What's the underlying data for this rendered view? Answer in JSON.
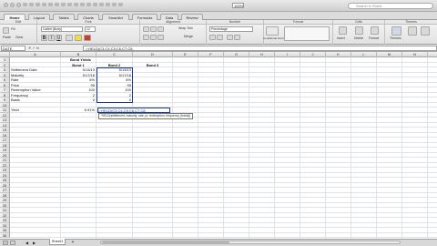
{
  "app": {
    "window_title": "bond_yields.xlsx",
    "zoom": "100%",
    "search_placeholder": "Search in Sheet"
  },
  "tabs": [
    {
      "label": "Home",
      "active": true
    },
    {
      "label": "Layout",
      "active": false
    },
    {
      "label": "Tables",
      "active": false
    },
    {
      "label": "Charts",
      "active": false
    },
    {
      "label": "SmartArt",
      "active": false
    },
    {
      "label": "Formulas",
      "active": false
    },
    {
      "label": "Data",
      "active": false
    },
    {
      "label": "Review",
      "active": false
    }
  ],
  "ribbon": {
    "groups": [
      "Edit",
      "Font",
      "Alignment",
      "Number",
      "Format",
      "Cells",
      "Themes"
    ],
    "fill_label": "Fill",
    "paste_label": "Paste",
    "clear_label": "Clear",
    "font_name": "Calibri (Body)",
    "font_size": "12",
    "wrap_text_label": "Wrap Text",
    "merge_label": "Merge",
    "number_format": "Percentage",
    "conditional_formatting_label": "Conditional Formatting",
    "insert_label": "Insert",
    "delete_label": "Delete",
    "format_label": "Format",
    "themes_label": "Themes"
  },
  "formula_bar": {
    "name_box": "DATE",
    "content": "=YIELD(C3,C4,C5,C6,C7,C8,"
  },
  "sheet": {
    "columns": [
      "A",
      "B",
      "C",
      "D",
      "E",
      "F",
      "G",
      "H",
      "I",
      "J",
      "K",
      "L",
      "M",
      "N",
      "O",
      "P",
      "Q"
    ],
    "row_count": 36,
    "title": "Bond Yields",
    "headers": {
      "b": "Bond 1",
      "c": "Bond 2",
      "d": "Bond 3"
    },
    "rows": [
      {
        "label": "Settlement Date",
        "b": "5/13/13",
        "c": "5/13/13"
      },
      {
        "label": "Maturity",
        "b": "5/17/18",
        "c": "5/17/18"
      },
      {
        "label": "Rate",
        "b": "6%",
        "c": "6%"
      },
      {
        "label": "Price",
        "b": "95",
        "c": "95"
      },
      {
        "label": "Redemption Value",
        "b": "100",
        "c": "100"
      },
      {
        "label": "Frequency",
        "b": "2",
        "c": "2"
      },
      {
        "label": "Basis",
        "b": "0",
        "c": "0"
      }
    ],
    "yield_label": "Yield",
    "yield_b": "6.91%",
    "yield_c_formula": "=YIELD(C3,C4,C5,C6,C7,C8,",
    "tooltip": "YIELD(settlement, maturity, rate, pr, redemption, frequency, [basis])"
  },
  "bottom": {
    "sheet_tab": "Sheet1",
    "view_label": "Normal View"
  }
}
